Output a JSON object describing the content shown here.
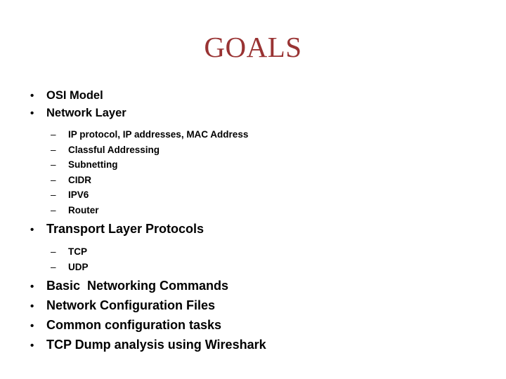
{
  "slide": {
    "title": "GOALS",
    "title_color": "#993333",
    "background_color": "#FFFFFF",
    "text_color": "#000000",
    "bullet_marker_level1": "•",
    "bullet_marker_level2": "–",
    "items": [
      {
        "level": 1,
        "text": "OSI Model"
      },
      {
        "level": 1,
        "text": "Network Layer"
      },
      {
        "level": 2,
        "text": "IP protocol, IP addresses, MAC Address"
      },
      {
        "level": 2,
        "text": "Classful Addressing"
      },
      {
        "level": 2,
        "text": "Subnetting"
      },
      {
        "level": 2,
        "text": "CIDR"
      },
      {
        "level": 2,
        "text": "IPV6"
      },
      {
        "level": 2,
        "text": "Router"
      },
      {
        "level": 1,
        "text": "Transport Layer Protocols"
      },
      {
        "level": 2,
        "text": "TCP"
      },
      {
        "level": 2,
        "text": "UDP"
      },
      {
        "level": 1,
        "text": "Basic  Networking Commands"
      },
      {
        "level": 1,
        "text": "Network Configuration Files"
      },
      {
        "level": 1,
        "text": "Common configuration tasks"
      },
      {
        "level": 1,
        "text": "TCP Dump analysis using Wireshark"
      }
    ]
  }
}
